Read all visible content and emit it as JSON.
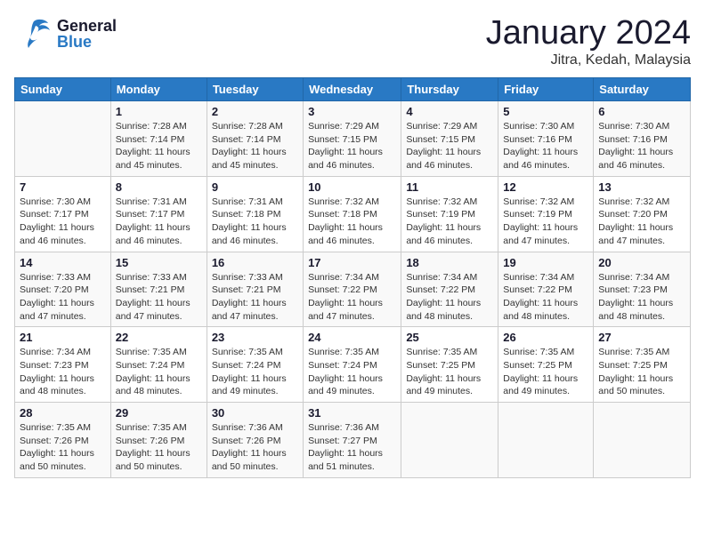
{
  "header": {
    "logo_general": "General",
    "logo_blue": "Blue",
    "month": "January 2024",
    "location": "Jitra, Kedah, Malaysia"
  },
  "days_of_week": [
    "Sunday",
    "Monday",
    "Tuesday",
    "Wednesday",
    "Thursday",
    "Friday",
    "Saturday"
  ],
  "weeks": [
    [
      {
        "day": "",
        "info": ""
      },
      {
        "day": "1",
        "info": "Sunrise: 7:28 AM\nSunset: 7:14 PM\nDaylight: 11 hours\nand 45 minutes."
      },
      {
        "day": "2",
        "info": "Sunrise: 7:28 AM\nSunset: 7:14 PM\nDaylight: 11 hours\nand 45 minutes."
      },
      {
        "day": "3",
        "info": "Sunrise: 7:29 AM\nSunset: 7:15 PM\nDaylight: 11 hours\nand 46 minutes."
      },
      {
        "day": "4",
        "info": "Sunrise: 7:29 AM\nSunset: 7:15 PM\nDaylight: 11 hours\nand 46 minutes."
      },
      {
        "day": "5",
        "info": "Sunrise: 7:30 AM\nSunset: 7:16 PM\nDaylight: 11 hours\nand 46 minutes."
      },
      {
        "day": "6",
        "info": "Sunrise: 7:30 AM\nSunset: 7:16 PM\nDaylight: 11 hours\nand 46 minutes."
      }
    ],
    [
      {
        "day": "7",
        "info": "Sunrise: 7:30 AM\nSunset: 7:17 PM\nDaylight: 11 hours\nand 46 minutes."
      },
      {
        "day": "8",
        "info": "Sunrise: 7:31 AM\nSunset: 7:17 PM\nDaylight: 11 hours\nand 46 minutes."
      },
      {
        "day": "9",
        "info": "Sunrise: 7:31 AM\nSunset: 7:18 PM\nDaylight: 11 hours\nand 46 minutes."
      },
      {
        "day": "10",
        "info": "Sunrise: 7:32 AM\nSunset: 7:18 PM\nDaylight: 11 hours\nand 46 minutes."
      },
      {
        "day": "11",
        "info": "Sunrise: 7:32 AM\nSunset: 7:19 PM\nDaylight: 11 hours\nand 46 minutes."
      },
      {
        "day": "12",
        "info": "Sunrise: 7:32 AM\nSunset: 7:19 PM\nDaylight: 11 hours\nand 47 minutes."
      },
      {
        "day": "13",
        "info": "Sunrise: 7:32 AM\nSunset: 7:20 PM\nDaylight: 11 hours\nand 47 minutes."
      }
    ],
    [
      {
        "day": "14",
        "info": "Sunrise: 7:33 AM\nSunset: 7:20 PM\nDaylight: 11 hours\nand 47 minutes."
      },
      {
        "day": "15",
        "info": "Sunrise: 7:33 AM\nSunset: 7:21 PM\nDaylight: 11 hours\nand 47 minutes."
      },
      {
        "day": "16",
        "info": "Sunrise: 7:33 AM\nSunset: 7:21 PM\nDaylight: 11 hours\nand 47 minutes."
      },
      {
        "day": "17",
        "info": "Sunrise: 7:34 AM\nSunset: 7:22 PM\nDaylight: 11 hours\nand 47 minutes."
      },
      {
        "day": "18",
        "info": "Sunrise: 7:34 AM\nSunset: 7:22 PM\nDaylight: 11 hours\nand 48 minutes."
      },
      {
        "day": "19",
        "info": "Sunrise: 7:34 AM\nSunset: 7:22 PM\nDaylight: 11 hours\nand 48 minutes."
      },
      {
        "day": "20",
        "info": "Sunrise: 7:34 AM\nSunset: 7:23 PM\nDaylight: 11 hours\nand 48 minutes."
      }
    ],
    [
      {
        "day": "21",
        "info": "Sunrise: 7:34 AM\nSunset: 7:23 PM\nDaylight: 11 hours\nand 48 minutes."
      },
      {
        "day": "22",
        "info": "Sunrise: 7:35 AM\nSunset: 7:24 PM\nDaylight: 11 hours\nand 48 minutes."
      },
      {
        "day": "23",
        "info": "Sunrise: 7:35 AM\nSunset: 7:24 PM\nDaylight: 11 hours\nand 49 minutes."
      },
      {
        "day": "24",
        "info": "Sunrise: 7:35 AM\nSunset: 7:24 PM\nDaylight: 11 hours\nand 49 minutes."
      },
      {
        "day": "25",
        "info": "Sunrise: 7:35 AM\nSunset: 7:25 PM\nDaylight: 11 hours\nand 49 minutes."
      },
      {
        "day": "26",
        "info": "Sunrise: 7:35 AM\nSunset: 7:25 PM\nDaylight: 11 hours\nand 49 minutes."
      },
      {
        "day": "27",
        "info": "Sunrise: 7:35 AM\nSunset: 7:25 PM\nDaylight: 11 hours\nand 50 minutes."
      }
    ],
    [
      {
        "day": "28",
        "info": "Sunrise: 7:35 AM\nSunset: 7:26 PM\nDaylight: 11 hours\nand 50 minutes."
      },
      {
        "day": "29",
        "info": "Sunrise: 7:35 AM\nSunset: 7:26 PM\nDaylight: 11 hours\nand 50 minutes."
      },
      {
        "day": "30",
        "info": "Sunrise: 7:36 AM\nSunset: 7:26 PM\nDaylight: 11 hours\nand 50 minutes."
      },
      {
        "day": "31",
        "info": "Sunrise: 7:36 AM\nSunset: 7:27 PM\nDaylight: 11 hours\nand 51 minutes."
      },
      {
        "day": "",
        "info": ""
      },
      {
        "day": "",
        "info": ""
      },
      {
        "day": "",
        "info": ""
      }
    ]
  ]
}
